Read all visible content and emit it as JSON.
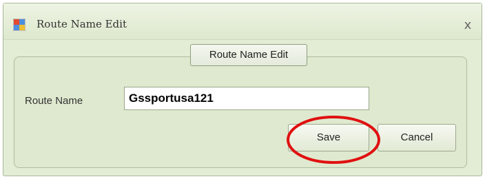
{
  "window": {
    "title": "Route Name Edit",
    "close_glyph": "x",
    "app_icon": "window-grid-icon",
    "accent_color": "#e3ecd4"
  },
  "group": {
    "title": "Route Name Edit"
  },
  "form": {
    "route_name_label": "Route Name",
    "route_name_value": "Gssportusa121"
  },
  "buttons": {
    "save_label": "Save",
    "cancel_label": "Cancel"
  },
  "annotation": {
    "highlight_color": "#e01010",
    "highlight_target": "save-button"
  }
}
